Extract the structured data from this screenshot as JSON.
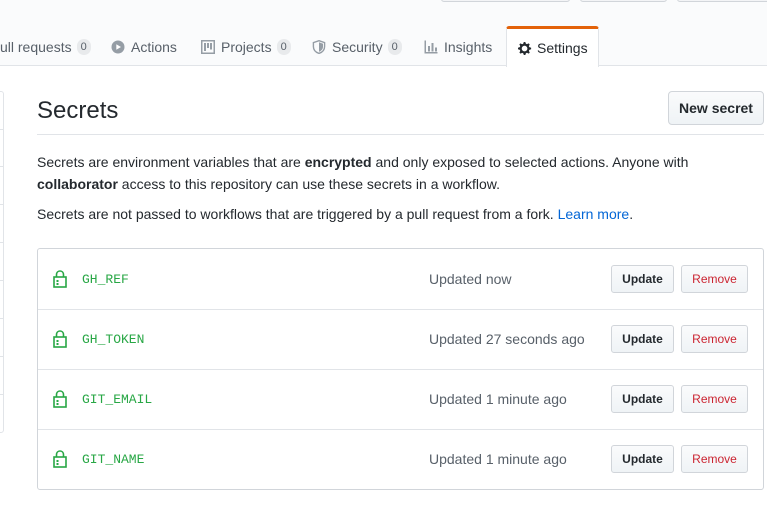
{
  "tabs": [
    {
      "label": "ull requests",
      "counter": "0",
      "icon": "pull-request-icon"
    },
    {
      "label": "Actions",
      "counter": null,
      "icon": "play-icon"
    },
    {
      "label": "Projects",
      "counter": "0",
      "icon": "project-icon"
    },
    {
      "label": "Security",
      "counter": "0",
      "icon": "shield-icon"
    },
    {
      "label": "Insights",
      "counter": null,
      "icon": "graph-icon"
    }
  ],
  "selected_tab": {
    "label": "Settings",
    "icon": "gear-icon"
  },
  "page": {
    "title": "Secrets",
    "new_secret_label": "New secret",
    "intro_part1": "Secrets are environment variables that are ",
    "intro_bold1": "encrypted",
    "intro_part2": " and only exposed to selected actions. Anyone with ",
    "intro_bold2": "collaborator",
    "intro_part3": " access to this repository can use these secrets in a workflow.",
    "fork_note": "Secrets are not passed to workflows that are triggered by a pull request from a fork. ",
    "learn_more": "Learn more",
    "fork_note_end": "."
  },
  "secrets": [
    {
      "name": "GH_REF",
      "updated": "Updated now"
    },
    {
      "name": "GH_TOKEN",
      "updated": "Updated 27 seconds ago"
    },
    {
      "name": "GIT_EMAIL",
      "updated": "Updated 1 minute ago"
    },
    {
      "name": "GIT_NAME",
      "updated": "Updated 1 minute ago"
    }
  ],
  "actions": {
    "update_label": "Update",
    "remove_label": "Remove"
  },
  "colors": {
    "accent": "#e36209",
    "secret_green": "#28a745",
    "remove_red": "#cb2431",
    "link": "#0366d6"
  }
}
